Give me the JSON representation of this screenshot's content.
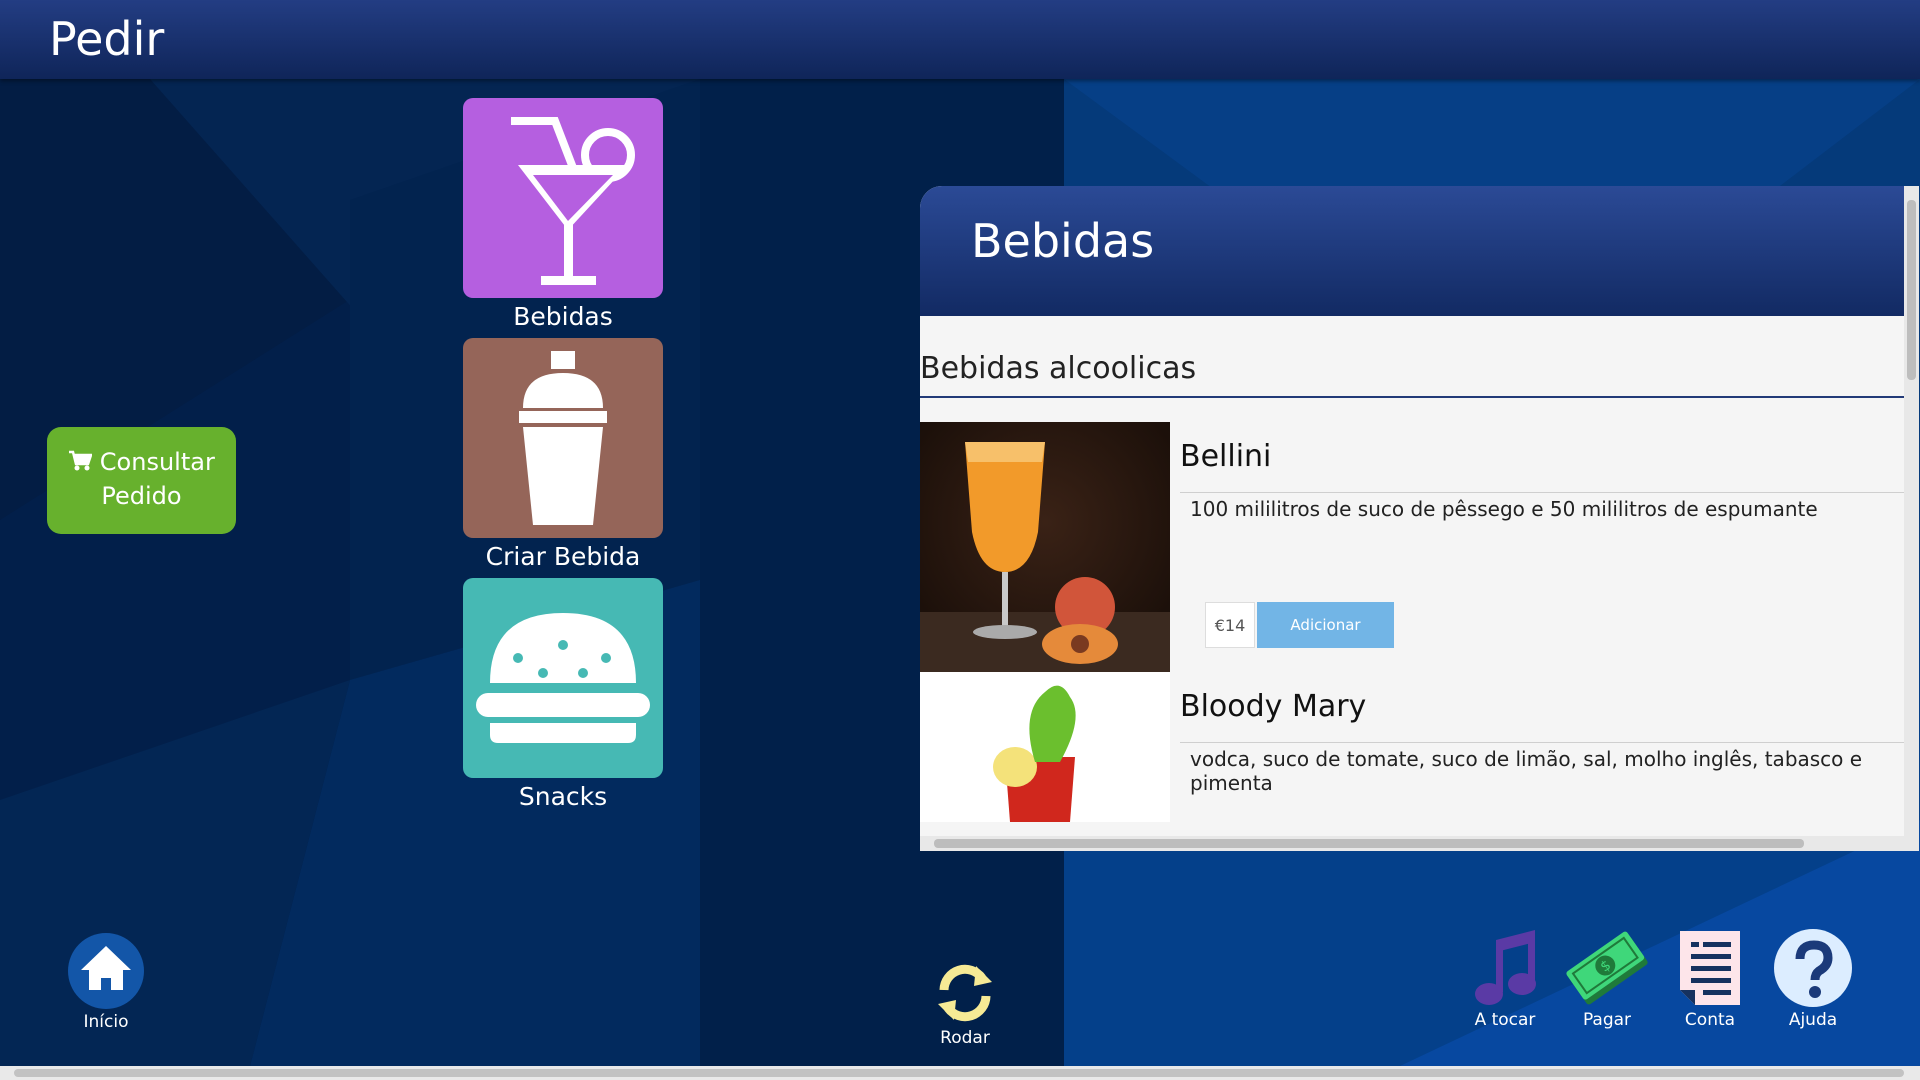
{
  "header": {
    "title": "Pedir"
  },
  "categories": [
    {
      "label": "Bebidas",
      "color": "#b55fe0",
      "icon": "cocktail-icon"
    },
    {
      "label": "Criar Bebida",
      "color": "#956559",
      "icon": "shaker-icon"
    },
    {
      "label": "Snacks",
      "color": "#46b9b4",
      "icon": "burger-icon"
    }
  ],
  "consult": {
    "label_line1": "Consultar",
    "label_line2": "Pedido",
    "icon": "cart-icon",
    "color": "#67b12d"
  },
  "panel": {
    "title": "Bebidas",
    "section": "Bebidas alcoolicas",
    "items": [
      {
        "name": "Bellini",
        "description": "100 mililitros de suco de pêssego e 50 mililitros de espumante",
        "price": "€14",
        "add_label": "Adicionar"
      },
      {
        "name": "Bloody Mary",
        "description": "vodca, suco de tomate, suco de limão, sal, molho inglês, tabasco e pimenta"
      }
    ]
  },
  "bottom_nav": {
    "home": "Início",
    "rotate": "Rodar",
    "playing": "A tocar",
    "pay": "Pagar",
    "bill": "Conta",
    "help": "Ajuda"
  }
}
